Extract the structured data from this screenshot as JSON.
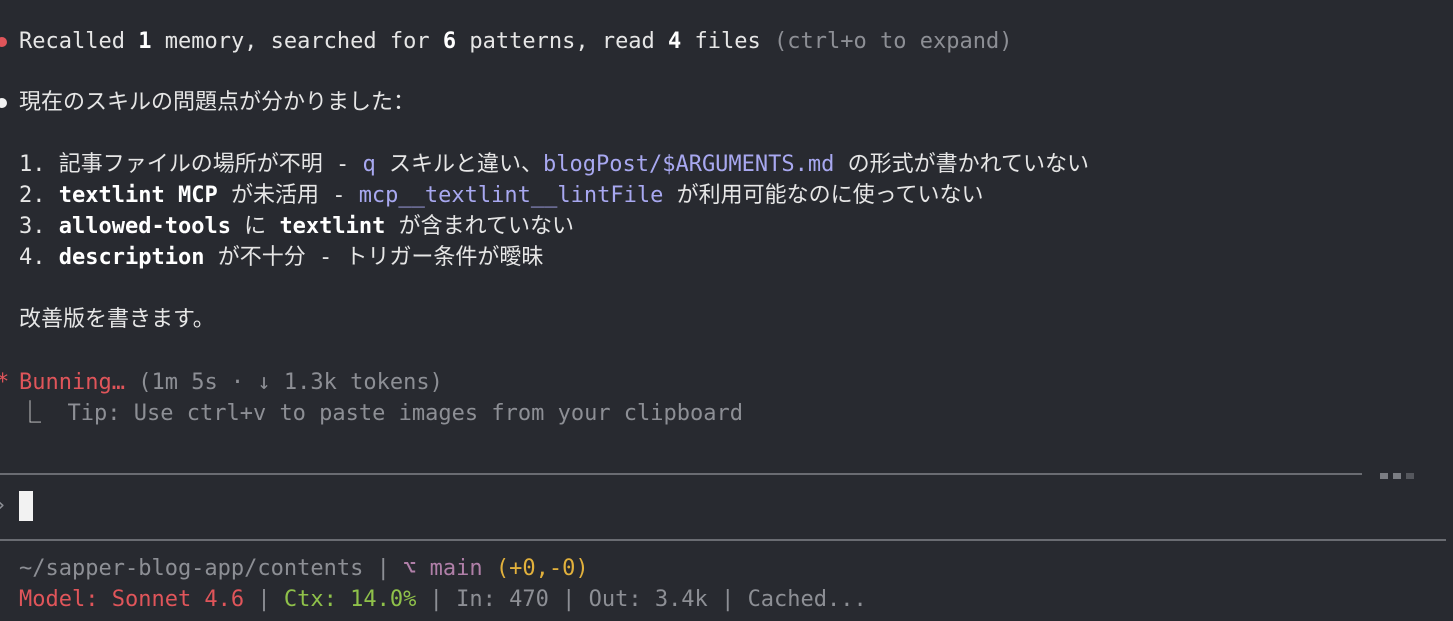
{
  "status": {
    "recalled_prefix": "Recalled ",
    "memory_count": "1",
    "memory_text": " memory, searched for ",
    "pattern_count": "6",
    "pattern_text": " patterns, read ",
    "file_count": "4",
    "file_text": " files",
    "expand_hint": "(ctrl+o to expand)"
  },
  "message": {
    "intro": "現在のスキルの問題点が分かりました：",
    "items": [
      {
        "num": "1.",
        "part1": "記事ファイルの場所が不明 - ",
        "code1": "q",
        "part2": " スキルと違い、",
        "code2": "blogPost/$ARGUMENTS.md",
        "part3": " の形式が書かれていない"
      },
      {
        "num": "2.",
        "bold1": "textlint MCP",
        "part1": " が未活用 - ",
        "code1": "mcp__textlint__lintFile",
        "part2": " が利用可能なのに使っていない"
      },
      {
        "num": "3.",
        "bold1": "allowed-tools",
        "part1": " に ",
        "bold2": "textlint",
        "part2": " が含まれていない"
      },
      {
        "num": "4.",
        "bold1": "description",
        "part1": " が不十分 - トリガー条件が曖昧"
      }
    ],
    "closing": "改善版を書きます。"
  },
  "progress": {
    "spinner": "*",
    "verb": "Bunning…",
    "stats": "(1m 5s · ↓ 1.3k tokens)",
    "tip_marker": "⎿",
    "tip": "Tip: Use ctrl+v to paste images from your clipboard"
  },
  "prompt": {
    "marker": "›",
    "value": ""
  },
  "statusline": {
    "path": "~/sapper-blog-app/contents",
    "branch_icon": "⌥",
    "branch": "main",
    "diff": "(+0,-0)",
    "model_label": "Model: Sonnet 4.6",
    "ctx_label": "Ctx: 14.0%",
    "in_label": "In: 470",
    "out_label": "Out: 3.4k",
    "cached_label": "Cached..."
  },
  "colors": {
    "background": "#282a30",
    "bullet_red": "#e0555a",
    "bullet_white": "#f2f2f2",
    "code": "#a8a8f0",
    "green": "#8fc14a",
    "yellow": "#e2b13c"
  }
}
